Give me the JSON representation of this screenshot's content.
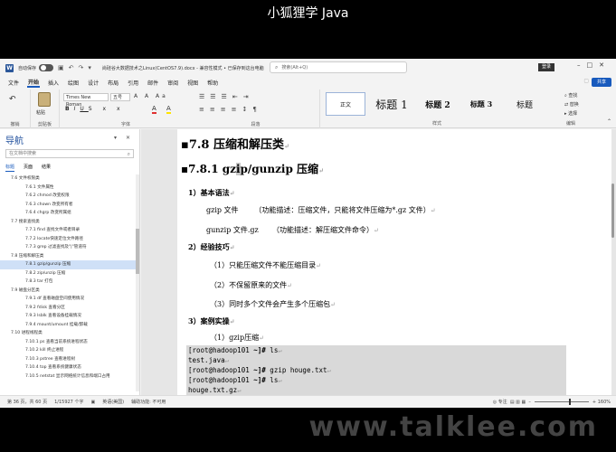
{
  "video": {
    "title": "小狐狸学 Java",
    "watermark": "www.talklee.com"
  },
  "titlebar": {
    "autosave_label": "自动保存",
    "doc_title": "尚硅谷大数据技术之Linux(CentOS7.9).docx - 兼容性模式 • 已保存到这台电脑",
    "search_placeholder": "搜索(Alt+Q)",
    "login_label": "登录"
  },
  "menu": {
    "tabs": [
      "文件",
      "开始",
      "插入",
      "绘图",
      "设计",
      "布局",
      "引用",
      "邮件",
      "审阅",
      "视图",
      "帮助"
    ],
    "active_tab": "开始",
    "share_label": "共享"
  },
  "ribbon": {
    "paste_label": "粘贴",
    "undo_label": "撤销",
    "clipboard_label": "剪贴板",
    "font_name": "Times New Roman",
    "font_size": "五号",
    "font_group_label": "字体",
    "paragraph_group_label": "段落",
    "styles_group_label": "样式",
    "editing_group_label": "编辑",
    "styles": [
      "正文",
      "标题 1",
      "标题 2",
      "标题 3",
      "标题"
    ],
    "editing": [
      "查找",
      "替换",
      "选择"
    ]
  },
  "nav": {
    "title": "导航",
    "search_placeholder": "在文档中搜索",
    "tabs": [
      "标题",
      "页面",
      "结果"
    ],
    "active_tab": "标题",
    "items": [
      {
        "label": "7.6 文件权限类",
        "level": 1
      },
      {
        "label": "7.6.1 文件属性",
        "level": 2
      },
      {
        "label": "7.6.2 chmod 改变权限",
        "level": 2
      },
      {
        "label": "7.6.3 chown 改变所有者",
        "level": 2
      },
      {
        "label": "7.6.4 chgrp 改变所属组",
        "level": 2
      },
      {
        "label": "7.7 搜索查找类",
        "level": 1
      },
      {
        "label": "7.7.1 find 查找文件或者目录",
        "level": 2
      },
      {
        "label": "7.7.2 locate快速定位文件路径",
        "level": 2
      },
      {
        "label": "7.7.3 grep 过滤查找及\"|\"管道符",
        "level": 2
      },
      {
        "label": "7.8 压缩和解压类",
        "level": 1
      },
      {
        "label": "7.8.1 gzip/gunzip 压缩",
        "level": 2,
        "selected": true
      },
      {
        "label": "7.8.2 zip/unzip 压缩",
        "level": 2
      },
      {
        "label": "7.8.3 tar 打包",
        "level": 2
      },
      {
        "label": "7.9 磁盘分区类",
        "level": 1
      },
      {
        "label": "7.9.1 df 查看磁盘空间使用情况",
        "level": 2
      },
      {
        "label": "7.9.2 fdisk 查看分区",
        "level": 2
      },
      {
        "label": "7.9.3 lsblk 查看设备挂载情况",
        "level": 2
      },
      {
        "label": "7.9.4 mount/umount 挂载/卸载",
        "level": 2
      },
      {
        "label": "7.10 进程线程类",
        "level": 1
      },
      {
        "label": "7.10.1 ps 查看当前系统进程状态",
        "level": 2
      },
      {
        "label": "7.10.2 kill 终止进程",
        "level": 2
      },
      {
        "label": "7.10.3 pstree 查看进程树",
        "level": 2
      },
      {
        "label": "7.10.4 top 查看系统健康状态",
        "level": 2
      },
      {
        "label": "7.10.5 netstat 显示网络统计信息和端口占用",
        "level": 2
      }
    ]
  },
  "doc": {
    "h2": "7.8 压缩和解压类",
    "h3_pre": "7.8.1 gz",
    "h3_sel": "i",
    "h3_post": "p/gunzip 压缩",
    "sec1": "1）基本语法",
    "syntax1_cmd": "gzip 文件",
    "syntax1_desc": "（功能描述：压缩文件，只能将文件压缩为*.gz 文件）",
    "syntax2_cmd": "gunzip 文件.gz",
    "syntax2_desc": "（功能描述：解压缩文件命令）",
    "sec2": "2）经验技巧",
    "tip1": "（1）只能压缩文件不能压缩目录",
    "tip2": "（2）不保留原来的文件",
    "tip3": "（3）同时多个文件会产生多个压缩包",
    "sec3": "3）案例实操",
    "case1": "（1）gzip压缩",
    "code": [
      {
        "prompt": "[root@hadoop101 ",
        "sym": "~]#",
        "cmd": " ls"
      },
      {
        "prompt": "test.java",
        "sym": "",
        "cmd": ""
      },
      {
        "prompt": "[root@hadoop101 ",
        "sym": "~]#",
        "cmd": " gzip houge.txt"
      },
      {
        "prompt": "[root@hadoop101 ",
        "sym": "~]#",
        "cmd": " ls"
      },
      {
        "prompt": "houge.txt.gz",
        "sym": "",
        "cmd": ""
      }
    ]
  },
  "status": {
    "page": "第 36 页，共 60 页",
    "words": "1/15927 个字",
    "lang": "英语(美国)",
    "accessibility": "辅助功能: 不可用",
    "focus": "专注",
    "zoom": "160%"
  }
}
